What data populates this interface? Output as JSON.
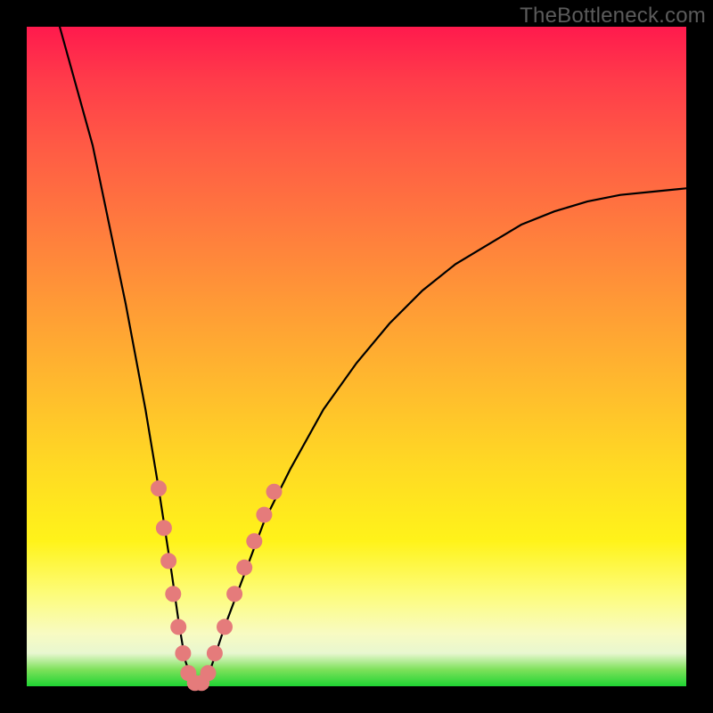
{
  "watermark": "TheBottleneck.com",
  "chart_data": {
    "type": "line",
    "title": "",
    "xlabel": "",
    "ylabel": "",
    "xlim": [
      0,
      100
    ],
    "ylim": [
      0,
      100
    ],
    "grid": false,
    "legend": null,
    "series": [
      {
        "name": "bottleneck-curve",
        "color": "#000000",
        "x": [
          5,
          10,
          15,
          18,
          20,
          22,
          23,
          24,
          25,
          26,
          27,
          28,
          30,
          33,
          36,
          40,
          45,
          50,
          55,
          60,
          65,
          70,
          75,
          80,
          85,
          90,
          95,
          100
        ],
        "y": [
          100,
          82,
          58,
          42,
          30,
          17,
          10,
          4,
          1,
          0,
          1,
          3,
          9,
          17,
          25,
          33,
          42,
          49,
          55,
          60,
          64,
          67,
          70,
          72,
          73.5,
          74.5,
          75,
          75.5
        ]
      }
    ],
    "markers": {
      "name": "highlight-dots",
      "color": "#e57b7b",
      "radius": 9,
      "points": [
        {
          "x": 20.0,
          "y": 30.0
        },
        {
          "x": 20.8,
          "y": 24.0
        },
        {
          "x": 21.5,
          "y": 19.0
        },
        {
          "x": 22.2,
          "y": 14.0
        },
        {
          "x": 23.0,
          "y": 9.0
        },
        {
          "x": 23.7,
          "y": 5.0
        },
        {
          "x": 24.5,
          "y": 2.0
        },
        {
          "x": 25.5,
          "y": 0.5
        },
        {
          "x": 26.5,
          "y": 0.5
        },
        {
          "x": 27.5,
          "y": 2.0
        },
        {
          "x": 28.5,
          "y": 5.0
        },
        {
          "x": 30.0,
          "y": 9.0
        },
        {
          "x": 31.5,
          "y": 14.0
        },
        {
          "x": 33.0,
          "y": 18.0
        },
        {
          "x": 34.5,
          "y": 22.0
        },
        {
          "x": 36.0,
          "y": 26.0
        },
        {
          "x": 37.5,
          "y": 29.5
        }
      ]
    }
  }
}
